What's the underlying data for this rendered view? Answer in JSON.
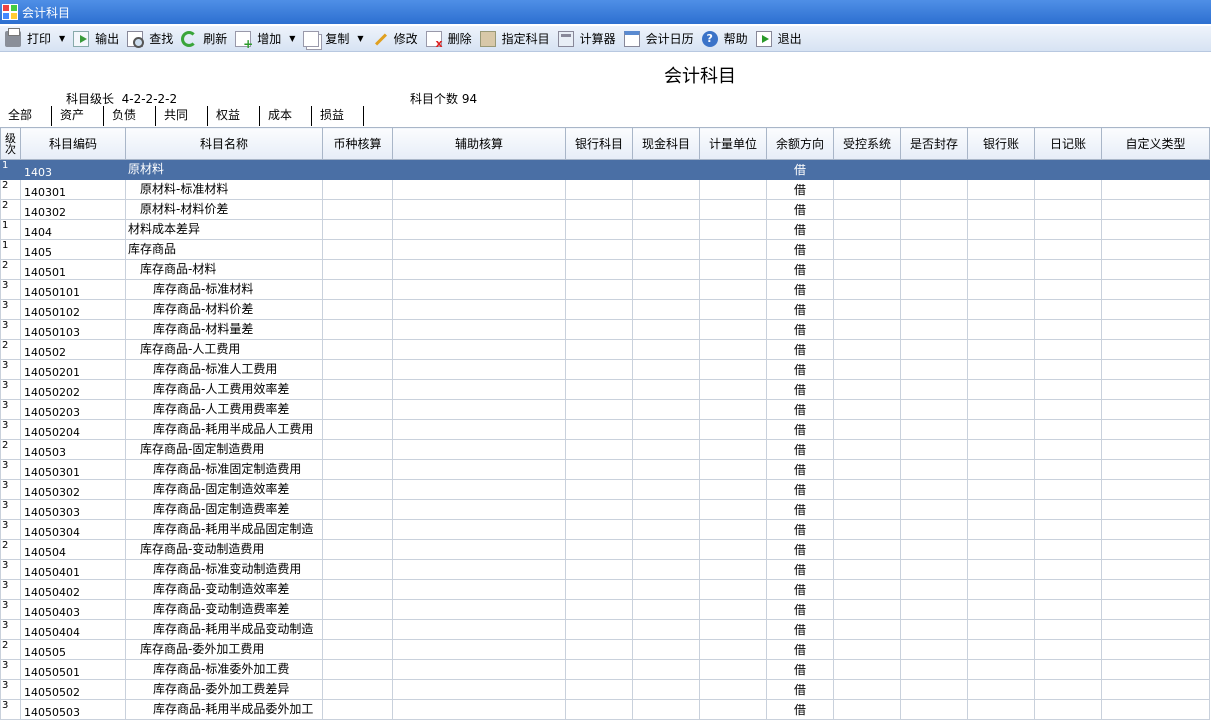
{
  "window": {
    "title": "会计科目"
  },
  "toolbar": {
    "print": "打印",
    "export": "输出",
    "find": "查找",
    "refresh": "刷新",
    "add": "增加",
    "copy": "复制",
    "edit": "修改",
    "delete": "删除",
    "assign": "指定科目",
    "calculator": "计算器",
    "calendar": "会计日历",
    "help": "帮助",
    "exit": "退出"
  },
  "report": {
    "title": "会计科目",
    "level_info": "科目级长  4-2-2-2-2",
    "count_info": "科目个数 94"
  },
  "tabs": [
    "全部",
    "资产",
    "负债",
    "共同",
    "权益",
    "成本",
    "损益"
  ],
  "active_tab": "资产",
  "columns": [
    "级次",
    "科目编码",
    "科目名称",
    "币种核算",
    "辅助核算",
    "银行科目",
    "现金科目",
    "计量单位",
    "余额方向",
    "受控系统",
    "是否封存",
    "银行账",
    "日记账",
    "自定义类型"
  ],
  "rows": [
    {
      "level": "1",
      "code": "1403",
      "name": "原材料",
      "dir": "借"
    },
    {
      "level": "2",
      "code": "140301",
      "name": "原材料-标准材料",
      "dir": "借"
    },
    {
      "level": "2",
      "code": "140302",
      "name": "原材料-材料价差",
      "dir": "借"
    },
    {
      "level": "1",
      "code": "1404",
      "name": "材料成本差异",
      "dir": "借"
    },
    {
      "level": "1",
      "code": "1405",
      "name": "库存商品",
      "dir": "借"
    },
    {
      "level": "2",
      "code": "140501",
      "name": "库存商品-材料",
      "dir": "借"
    },
    {
      "level": "3",
      "code": "14050101",
      "name": "库存商品-标准材料",
      "dir": "借"
    },
    {
      "level": "3",
      "code": "14050102",
      "name": "库存商品-材料价差",
      "dir": "借"
    },
    {
      "level": "3",
      "code": "14050103",
      "name": "库存商品-材料量差",
      "dir": "借"
    },
    {
      "level": "2",
      "code": "140502",
      "name": "库存商品-人工费用",
      "dir": "借"
    },
    {
      "level": "3",
      "code": "14050201",
      "name": "库存商品-标准人工费用",
      "dir": "借"
    },
    {
      "level": "3",
      "code": "14050202",
      "name": "库存商品-人工费用效率差",
      "dir": "借"
    },
    {
      "level": "3",
      "code": "14050203",
      "name": "库存商品-人工费用费率差",
      "dir": "借"
    },
    {
      "level": "3",
      "code": "14050204",
      "name": "库存商品-耗用半成品人工费用",
      "dir": "借"
    },
    {
      "level": "2",
      "code": "140503",
      "name": "库存商品-固定制造费用",
      "dir": "借"
    },
    {
      "level": "3",
      "code": "14050301",
      "name": "库存商品-标准固定制造费用",
      "dir": "借"
    },
    {
      "level": "3",
      "code": "14050302",
      "name": "库存商品-固定制造效率差",
      "dir": "借"
    },
    {
      "level": "3",
      "code": "14050303",
      "name": "库存商品-固定制造费率差",
      "dir": "借"
    },
    {
      "level": "3",
      "code": "14050304",
      "name": "库存商品-耗用半成品固定制造",
      "dir": "借"
    },
    {
      "level": "2",
      "code": "140504",
      "name": "库存商品-变动制造费用",
      "dir": "借"
    },
    {
      "level": "3",
      "code": "14050401",
      "name": "库存商品-标准变动制造费用",
      "dir": "借"
    },
    {
      "level": "3",
      "code": "14050402",
      "name": "库存商品-变动制造效率差",
      "dir": "借"
    },
    {
      "level": "3",
      "code": "14050403",
      "name": "库存商品-变动制造费率差",
      "dir": "借"
    },
    {
      "level": "3",
      "code": "14050404",
      "name": "库存商品-耗用半成品变动制造",
      "dir": "借"
    },
    {
      "level": "2",
      "code": "140505",
      "name": "库存商品-委外加工费用",
      "dir": "借"
    },
    {
      "level": "3",
      "code": "14050501",
      "name": "库存商品-标准委外加工费",
      "dir": "借"
    },
    {
      "level": "3",
      "code": "14050502",
      "name": "库存商品-委外加工费差异",
      "dir": "借"
    },
    {
      "level": "3",
      "code": "14050503",
      "name": "库存商品-耗用半成品委外加工",
      "dir": "借"
    }
  ],
  "selected_row": 0,
  "colors": {
    "titlebar": "#2d6fd0",
    "selected": "#4a6fa5"
  }
}
